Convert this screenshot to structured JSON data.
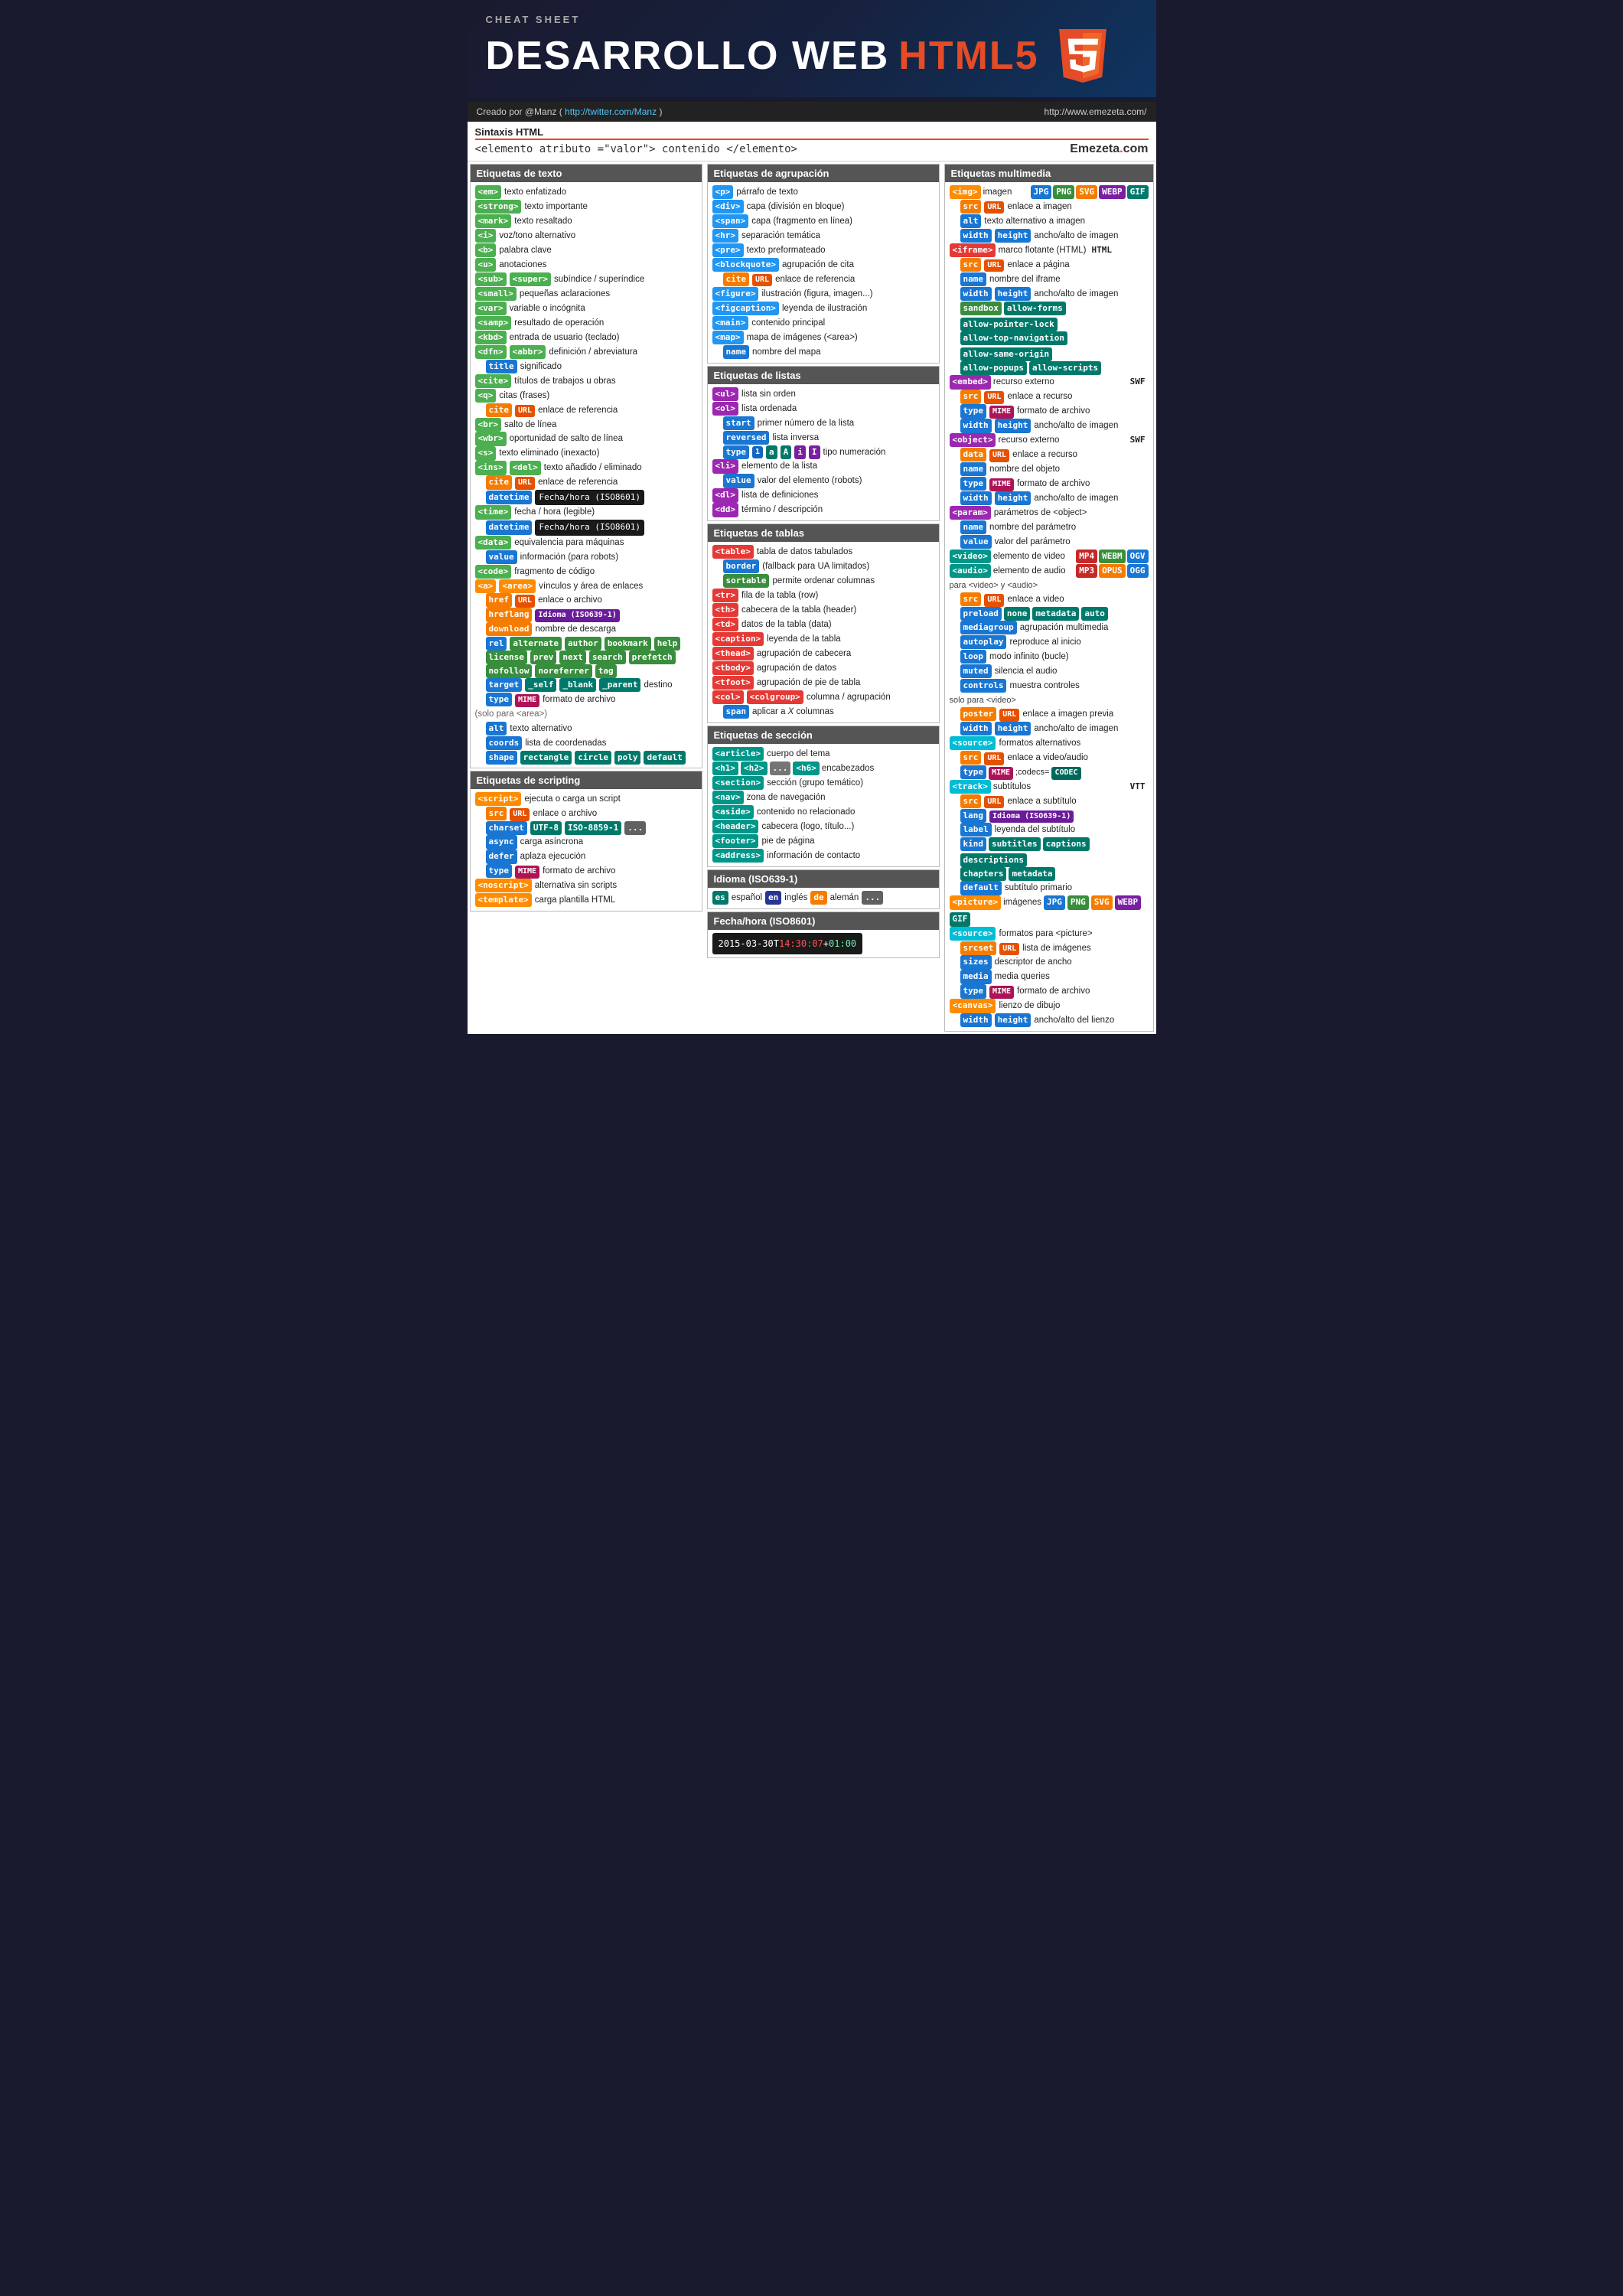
{
  "header": {
    "cheat_label": "CHEAT SHEET",
    "title_main": "DESARROLLO WEB ",
    "title_html5": "HTML5",
    "credit": "Creado por @Manz ( http://twitter.com/Manz )",
    "website": "http://www.emezeta.com/"
  },
  "syntax": {
    "title": "Sintaxis HTML",
    "code": "<elemento  atributo =\"valor\"> contenido </elemento>"
  }
}
